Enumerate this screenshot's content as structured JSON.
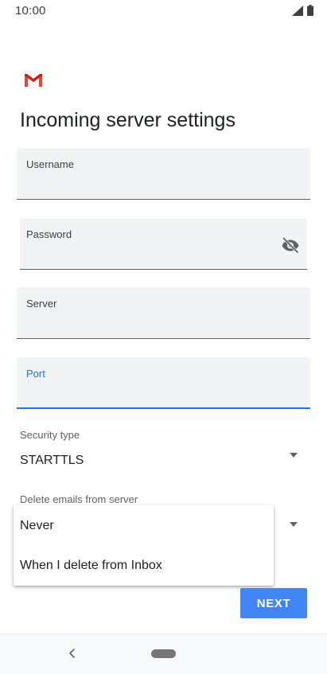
{
  "status_bar": {
    "time": "10:00"
  },
  "header": {
    "app_logo": "gmail-logo",
    "title": "Incoming server settings"
  },
  "fields": {
    "username": {
      "label": "Username",
      "value": ""
    },
    "password": {
      "label": "Password",
      "value": "",
      "toggle_icon": "visibility-off-icon"
    },
    "server": {
      "label": "Server",
      "value": ""
    },
    "port": {
      "label": "Port",
      "value": ""
    }
  },
  "security_type": {
    "label": "Security type",
    "value": "STARTTLS"
  },
  "delete_emails": {
    "label": "Delete emails from server",
    "options": [
      "Never",
      "When I delete from Inbox"
    ]
  },
  "actions": {
    "next_label": "NEXT"
  },
  "colors": {
    "accent": "#1a73e8",
    "button": "#4285f4",
    "field_bg": "#f1f3f4",
    "gmail_red": "#ea4335"
  }
}
